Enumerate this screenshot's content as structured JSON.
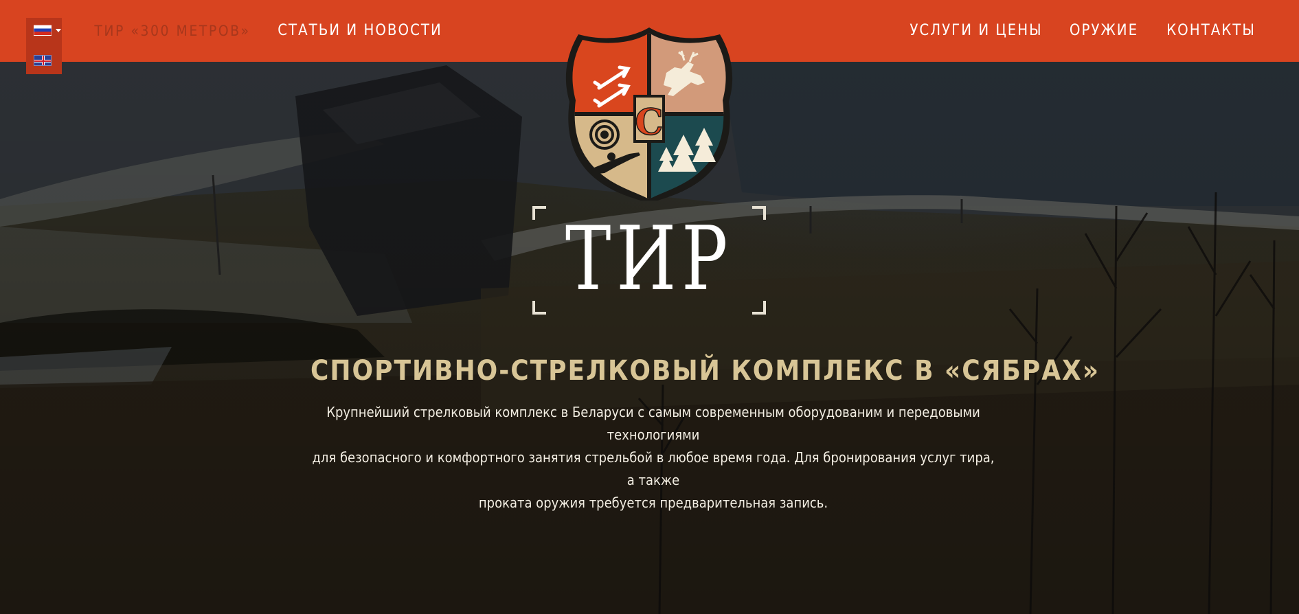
{
  "page": {
    "title": "Спортивно-стрелковый комплекс в «Сябрах»"
  },
  "colors": {
    "nav_background": "#d84420",
    "nav_active_text": "#a7371c",
    "subtitle_gold": "#d8c596",
    "emblem_orange": "#d9461e",
    "emblem_teal": "#1c4a4f",
    "emblem_sand": "#d6b98a"
  },
  "language_switcher": {
    "current": "flag-ru-icon",
    "options": [
      "flag-ru-icon",
      "flag-uk-icon"
    ]
  },
  "nav": {
    "shooting_range": "ТИР «300 МЕТРОВ»",
    "articles": "СТАТЬИ И НОВОСТИ",
    "services": "УСЛУГИ И ЦЕНЫ",
    "weapons": "ОРУЖИЕ",
    "contacts": "КОНТАКТЫ"
  },
  "emblem": {
    "icons": [
      "arrows-icon",
      "deer-icon",
      "target-icon",
      "letter-c-icon",
      "shooter-icon",
      "forest-icon"
    ],
    "letter": "C"
  },
  "hero": {
    "title": "ТИР",
    "subtitle": "СПОРТИВНО-СТРЕЛКОВЫЙ КОМПЛЕКС В «СЯБРАХ»",
    "description_lines": [
      "Крупнейший стрелковый комплекс в Беларуси с самым современным оборудованим и передовыми технологиями",
      "для безопасного и комфортного занятия стрельбой в любое время года. Для бронирования услуг тира, а также",
      "проката оружия требуется предварительная запись."
    ]
  }
}
